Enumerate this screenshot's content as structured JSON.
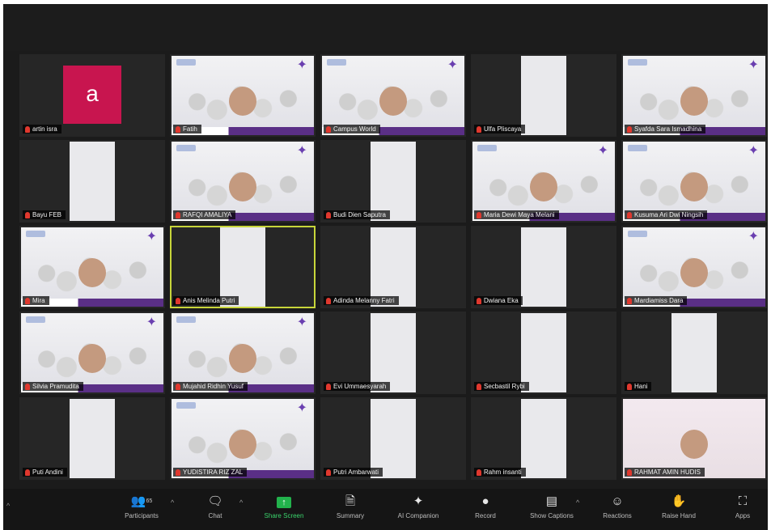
{
  "participants": [
    {
      "name": "artin isra",
      "kind": "avatar",
      "initial": "a"
    },
    {
      "name": "Fatih",
      "kind": "bg"
    },
    {
      "name": "Campus World",
      "kind": "bg"
    },
    {
      "name": "Ulfa Pliscaya",
      "kind": "narrow"
    },
    {
      "name": "Syafda Sara Ismadhina",
      "kind": "bg"
    },
    {
      "name": "Bayu FEB",
      "kind": "narrow"
    },
    {
      "name": "RAFQI AMALIYA",
      "kind": "bg"
    },
    {
      "name": "Budi Dien Saputra",
      "kind": "narrow"
    },
    {
      "name": "Maria Dewi Maya Melani",
      "kind": "bg"
    },
    {
      "name": "Kusuma Ari Dwi Ningsih",
      "kind": "bg"
    },
    {
      "name": "Mira",
      "kind": "bg"
    },
    {
      "name": "Anis Melinda Putri",
      "kind": "narrow",
      "active": true
    },
    {
      "name": "Adinda Melanny Fatri",
      "kind": "narrow"
    },
    {
      "name": "Dwiana Eka",
      "kind": "narrow"
    },
    {
      "name": "Mardiamiss Dara",
      "kind": "bg"
    },
    {
      "name": "Silvia Pramudita",
      "kind": "bg"
    },
    {
      "name": "Mujahid Ridhin Yusuf",
      "kind": "bg"
    },
    {
      "name": "Evi Ummaesyarah",
      "kind": "narrow"
    },
    {
      "name": "Secbastil Rybi",
      "kind": "narrow"
    },
    {
      "name": "Hani",
      "kind": "narrow"
    },
    {
      "name": "Puti Andini",
      "kind": "narrow"
    },
    {
      "name": "YUDISTIRA RIZ ZAL",
      "kind": "bg"
    },
    {
      "name": "Putri Ambarwati",
      "kind": "narrow"
    },
    {
      "name": "Rahm insanti",
      "kind": "narrow"
    },
    {
      "name": "RAHMAT AMIN HUDIS",
      "kind": "plain"
    }
  ],
  "toolbar": {
    "participants_label": "Participants",
    "participants_count": "65",
    "chat_label": "Chat",
    "share_label": "Share Screen",
    "summary_label": "Summary",
    "ai_label": "AI Companion",
    "record_label": "Record",
    "captions_label": "Show Captions",
    "reactions_label": "Reactions",
    "raise_label": "Raise Hand",
    "apps_label": "Apps"
  },
  "colors": {
    "share_green": "#22b24c",
    "mic_muted_red": "#e0382e",
    "active_speaker_border": "#c7d53a",
    "avatar_bg": "#c8154f",
    "banner_purple": "#5a2f86"
  }
}
